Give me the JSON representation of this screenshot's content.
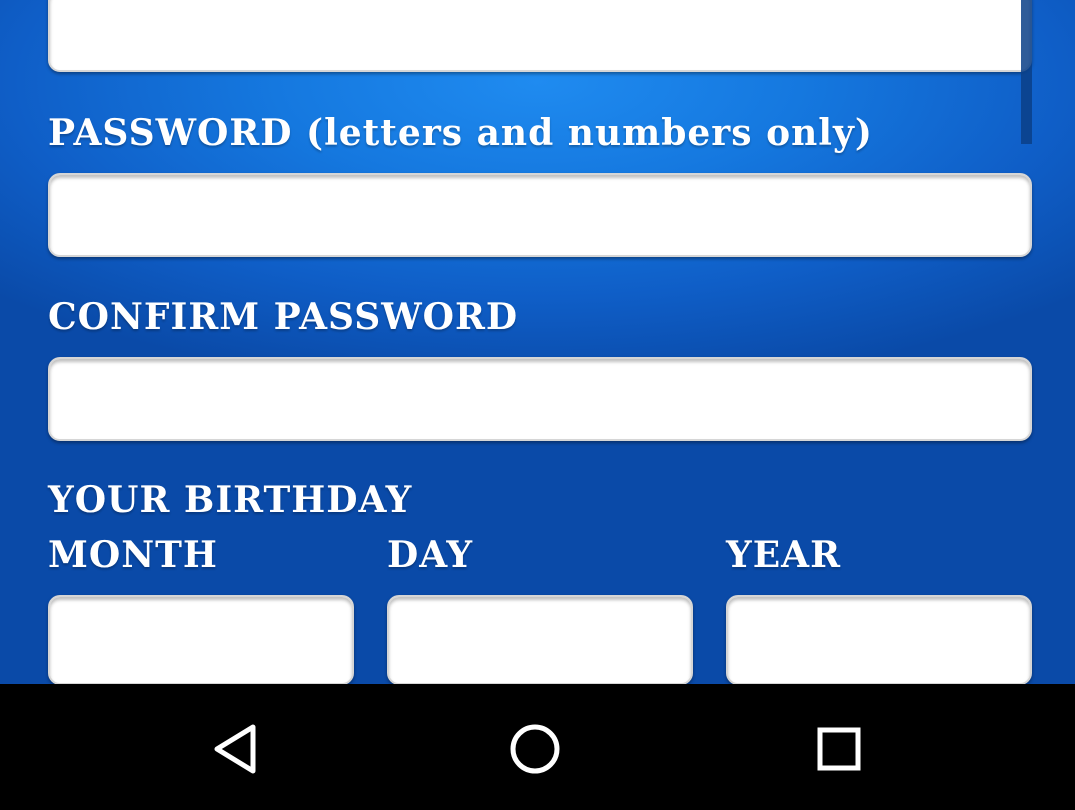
{
  "form": {
    "password_label": "PASSWORD (letters and numbers only)",
    "confirm_label": "CONFIRM PASSWORD",
    "birthday_label": "YOUR BIRTHDAY",
    "month_label": "MONTH",
    "day_label": "DAY",
    "year_label": "YEAR",
    "previous_field_value": "",
    "password_value": "",
    "confirm_value": "",
    "month_value": "",
    "day_value": "",
    "year_value": ""
  },
  "navbar": {
    "back_icon": "triangle-back-icon",
    "home_icon": "circle-home-icon",
    "recents_icon": "square-recents-icon"
  },
  "colors": {
    "background_top": "#1f8bf0",
    "background_bottom": "#0a4aa8",
    "label": "#ffffff",
    "field": "#ffffff",
    "navbar": "#000000"
  }
}
